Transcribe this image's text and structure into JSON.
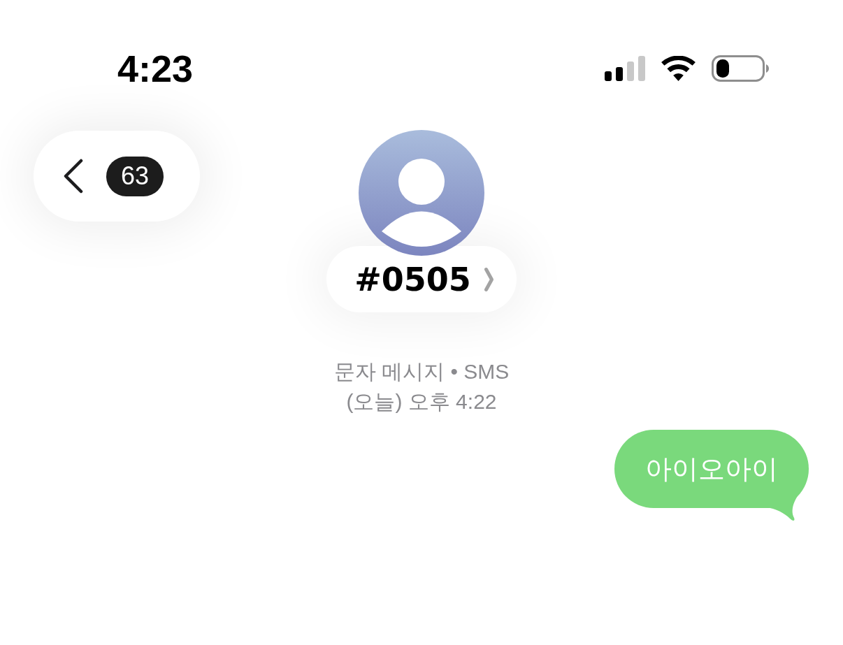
{
  "status_bar": {
    "time": "4:23"
  },
  "header": {
    "back_button": {
      "unread_count": "63"
    },
    "contact": {
      "name": "#0505"
    }
  },
  "thread_info": {
    "service": "문자 메시지 • SMS",
    "timestamp": "(오늘) 오후 4:22"
  },
  "messages": [
    {
      "kind": "sent",
      "text": "아이오아이"
    }
  ]
}
